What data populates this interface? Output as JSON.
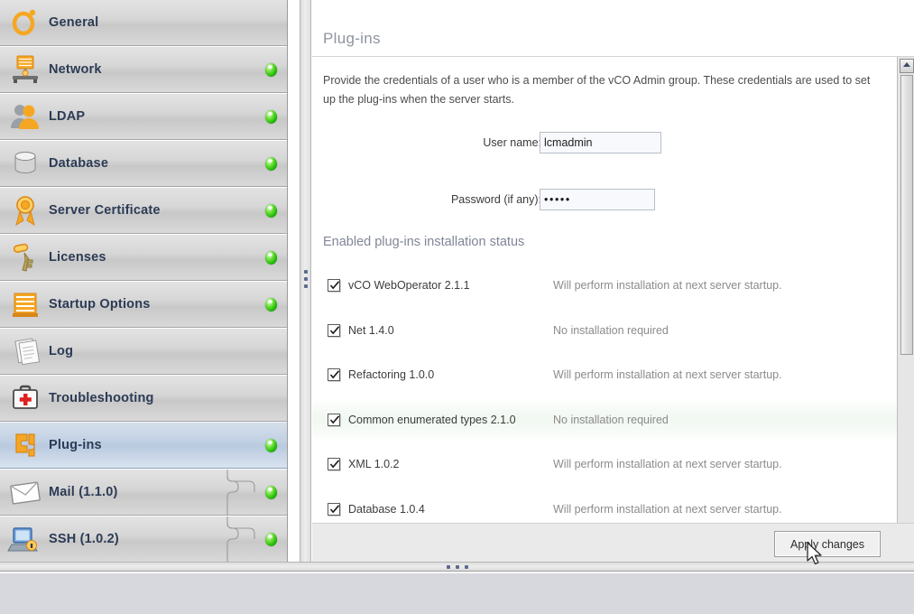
{
  "sidebar": {
    "items": [
      {
        "label": "General",
        "icon": "orbit-icon",
        "status": "",
        "child": false
      },
      {
        "label": "Network",
        "icon": "network-icon",
        "status": "green",
        "child": false
      },
      {
        "label": "LDAP",
        "icon": "users-icon",
        "status": "green",
        "child": false
      },
      {
        "label": "Database",
        "icon": "database-icon",
        "status": "green",
        "child": false
      },
      {
        "label": "Server Certificate",
        "icon": "certificate-icon",
        "status": "green",
        "child": false
      },
      {
        "label": "Licenses",
        "icon": "key-icon",
        "status": "green",
        "child": false
      },
      {
        "label": "Startup Options",
        "icon": "server-stack-icon",
        "status": "green",
        "child": false
      },
      {
        "label": "Log",
        "icon": "documents-icon",
        "status": "",
        "child": false
      },
      {
        "label": "Troubleshooting",
        "icon": "first-aid-kit-icon",
        "status": "",
        "child": false
      },
      {
        "label": "Plug-ins",
        "icon": "plugin-icon",
        "status": "green",
        "child": false,
        "selected": true
      },
      {
        "label": "Mail (1.1.0)",
        "icon": "mail-icon",
        "status": "green",
        "child": true
      },
      {
        "label": "SSH (1.0.2)",
        "icon": "ssh-computer-icon",
        "status": "green",
        "child": true
      }
    ],
    "scroll": {
      "up_arrow": "scroll-up-icon",
      "down_arrow": "scroll-down-icon"
    }
  },
  "content": {
    "title": "Plug-ins",
    "intro": "Provide the credentials of a user who is a member of the vCO Admin group. These credentials are used to set up the plug-ins when the server starts.",
    "fields": {
      "username_label": "User name:",
      "username_value": "lcmadmin",
      "username_placeholder": "",
      "password_label": "Password (if any):",
      "password_value": "•••••",
      "password_placeholder": ""
    },
    "section_title": "Enabled plug-ins installation status",
    "plugins": [
      {
        "checked": true,
        "name": "vCO WebOperator 2.1.1",
        "status": "Will perform installation at next server startup."
      },
      {
        "checked": true,
        "name": "Net 1.4.0",
        "status": "No installation required"
      },
      {
        "checked": true,
        "name": "Refactoring 1.0.0",
        "status": "Will perform installation at next server startup."
      },
      {
        "checked": true,
        "name": "Common enumerated types 2.1.0",
        "status": "No installation required"
      },
      {
        "checked": true,
        "name": "XML 1.0.2",
        "status": "Will perform installation at next server startup."
      },
      {
        "checked": true,
        "name": "Database 1.0.4",
        "status": "Will perform installation at next server startup."
      }
    ],
    "apply_label": "Apply changes"
  },
  "colors": {
    "accent_orange": "#f5a723",
    "status_green": "#22b400",
    "label_blue": "#2c3b55",
    "title_gray": "#8e94a0",
    "selected_blue": "#b9cadf"
  }
}
